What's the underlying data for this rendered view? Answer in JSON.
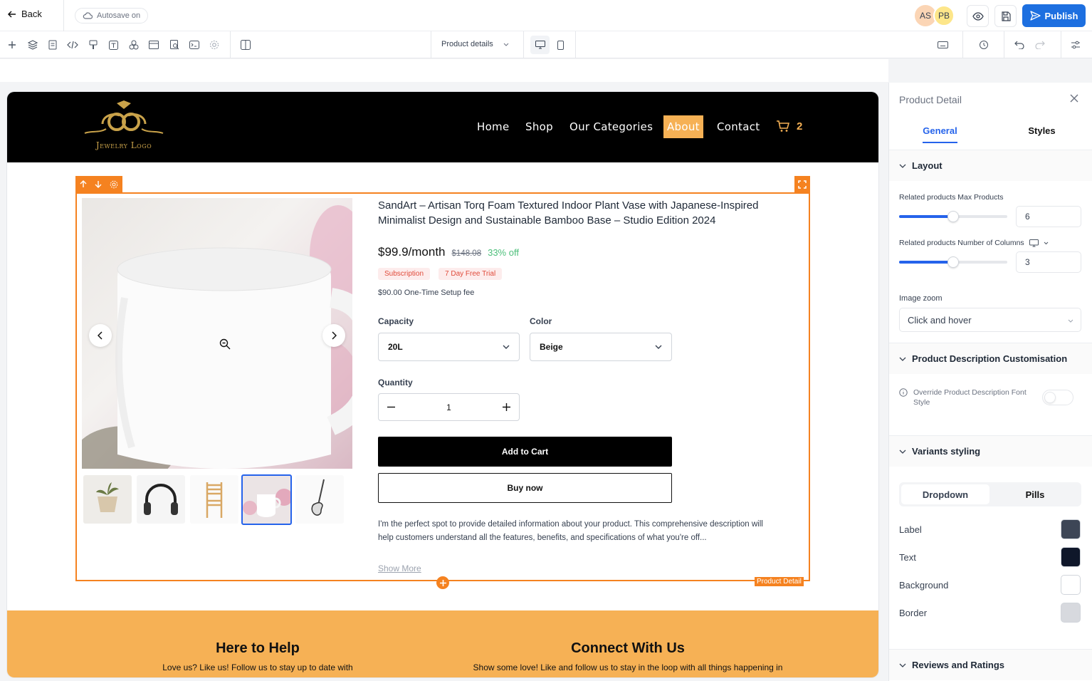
{
  "topbar": {
    "back_label": "Back",
    "autosave_label": "Autosave on",
    "avatars": [
      "AS",
      "PB"
    ],
    "publish_label": "Publish"
  },
  "toolbar": {
    "page_select": "Product details"
  },
  "site": {
    "logo_text": "Jewelry Logo",
    "nav": [
      "Home",
      "Shop",
      "Our Categories",
      "About",
      "Contact"
    ],
    "cart_count": "2",
    "accent": "#f6b155"
  },
  "product": {
    "title": "SandArt – Artisan Torq Foam Textured Indoor Plant Vase with Japanese-Inspired Minimalist Design and Sustainable Bamboo Base – Studio Edition 2024",
    "price": "$99.9/month",
    "old_price": "$148.08",
    "discount": "33% off",
    "badges": [
      "Subscription",
      "7 Day Free Trial"
    ],
    "setup_fee": "$90.00 One-Time Setup fee",
    "capacity_label": "Capacity",
    "capacity_value": "20L",
    "color_label": "Color",
    "color_value": "Beige",
    "quantity_label": "Quantity",
    "quantity_value": "1",
    "add_to_cart": "Add to Cart",
    "buy_now": "Buy now",
    "description": "I'm the perfect spot to provide detailed information about your product. This comprehensive description will help customers understand all the features, benefits, and specifications of what you're off...",
    "show_more": "Show More",
    "element_tag": "Product Detail"
  },
  "footer": {
    "col1_title": "Here to Help",
    "col1_text": "Love us? Like us! Follow us to stay up to date with",
    "col2_title": "Connect With Us",
    "col2_text": "Show some love! Like and follow us to stay in the loop with all things happening in"
  },
  "panel": {
    "title": "Product Detail",
    "tabs": [
      "General",
      "Styles"
    ],
    "layout_section": "Layout",
    "max_products_label": "Related products Max Products",
    "max_products_value": "6",
    "columns_label": "Related products Number of Columns",
    "columns_value": "3",
    "image_zoom_label": "Image zoom",
    "image_zoom_value": "Click and hover",
    "desc_section": "Product Description Customisation",
    "override_label": "Override Product Description Font Style",
    "variants_section": "Variants styling",
    "variant_toggle": [
      "Dropdown",
      "Pills"
    ],
    "color_rows": [
      {
        "label": "Label",
        "color": "#3d4656"
      },
      {
        "label": "Text",
        "color": "#0f172a"
      },
      {
        "label": "Background",
        "color": "#ffffff"
      },
      {
        "label": "Border",
        "color": "#d7d9de"
      }
    ],
    "reviews_section": "Reviews and Ratings",
    "slider_max_products_fraction": 0.5,
    "slider_columns_fraction": 0.5
  },
  "colors": {
    "publish": "#1d6fe0",
    "selection": "#f58220",
    "footer_bg": "#f6b155"
  }
}
